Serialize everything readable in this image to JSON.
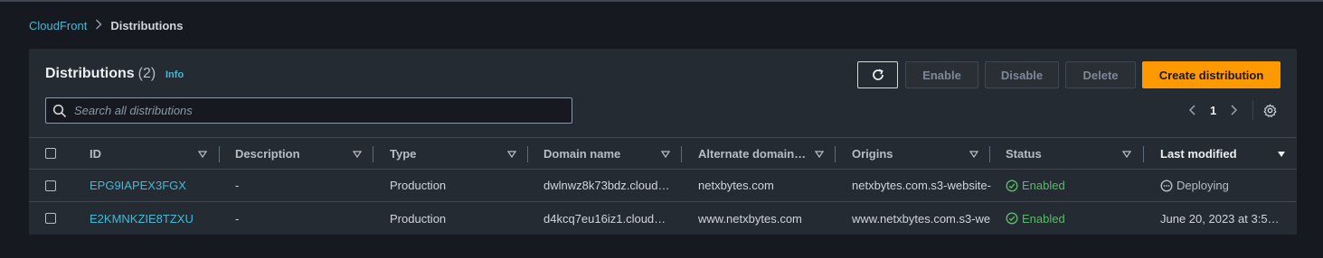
{
  "breadcrumb": {
    "root": "CloudFront",
    "current": "Distributions"
  },
  "panel": {
    "title": "Distributions",
    "count": "(2)",
    "info": "Info"
  },
  "toolbar": {
    "refresh_icon": "refresh-icon",
    "enable": "Enable",
    "disable": "Disable",
    "delete": "Delete",
    "create": "Create distribution"
  },
  "search": {
    "placeholder": "Search all distributions",
    "value": ""
  },
  "pagination": {
    "page": "1"
  },
  "table": {
    "headers": [
      "ID",
      "Description",
      "Type",
      "Domain name",
      "Alternate domain…",
      "Origins",
      "Status",
      "Last modified"
    ],
    "rows": [
      {
        "id": "EPG9IAPEX3FGX",
        "description": "-",
        "type": "Production",
        "domain": "dwlnwz8k73bdz.cloud…",
        "alternate": "netxbytes.com",
        "origins": "netxbytes.com.s3-website-",
        "status": "Enabled",
        "last_modified": "Deploying"
      },
      {
        "id": "E2KMNKZIE8TZXU",
        "description": "-",
        "type": "Production",
        "domain": "d4kcq7eu16iz1.cloud…",
        "alternate": "www.netxbytes.com",
        "origins": "www.netxbytes.com.s3-we",
        "status": "Enabled",
        "last_modified": "June 20, 2023 at 3:5…"
      }
    ]
  },
  "colors": {
    "accent_link": "#44b9d6",
    "primary_button": "#ff9900",
    "status_ok": "#5bb86a",
    "background": "#16191f",
    "panel": "#252b33"
  }
}
